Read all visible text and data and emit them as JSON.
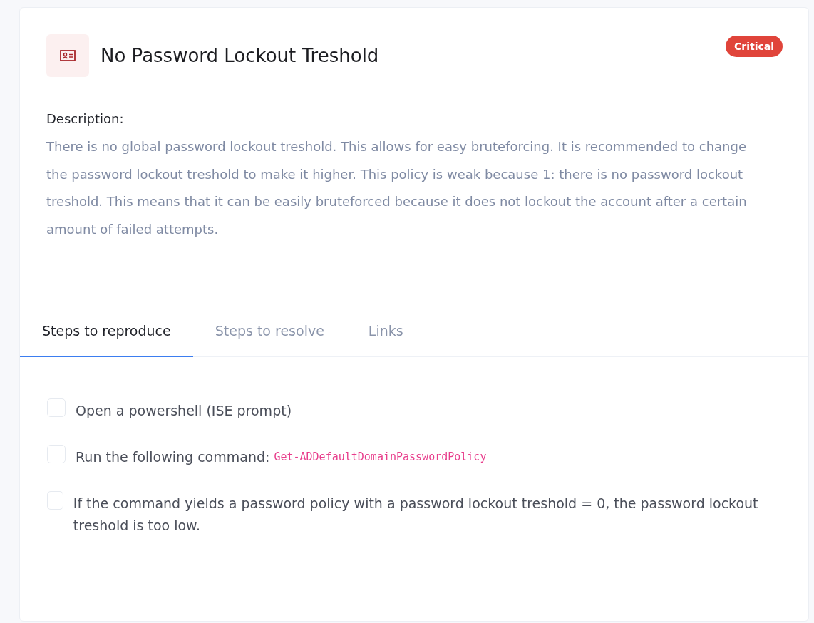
{
  "header": {
    "title": "No Password Lockout Treshold",
    "severity": {
      "label": "Critical",
      "color": "#e0443a"
    }
  },
  "description": {
    "label": "Description:",
    "text": "There is no global password lockout treshold. This allows for easy bruteforcing. It is recommended to change the password lockout treshold to make it higher. This policy is weak because 1: there is no password lockout treshold. This means that it can be easily bruteforced because it does not lockout the account after a certain amount of failed attempts."
  },
  "tabs": [
    {
      "label": "Steps to reproduce",
      "selected": true
    },
    {
      "label": "Steps to resolve",
      "selected": false
    },
    {
      "label": "Links",
      "selected": false
    }
  ],
  "steps": [
    {
      "text": "Open a powershell (ISE prompt)",
      "checked": false
    },
    {
      "text": "Run the following command:",
      "code": "Get-ADDefaultDomainPasswordPolicy",
      "checked": false
    },
    {
      "text": "If the command yields a password policy with a password lockout treshold = 0, the password lockout treshold is too low.",
      "checked": false
    }
  ]
}
